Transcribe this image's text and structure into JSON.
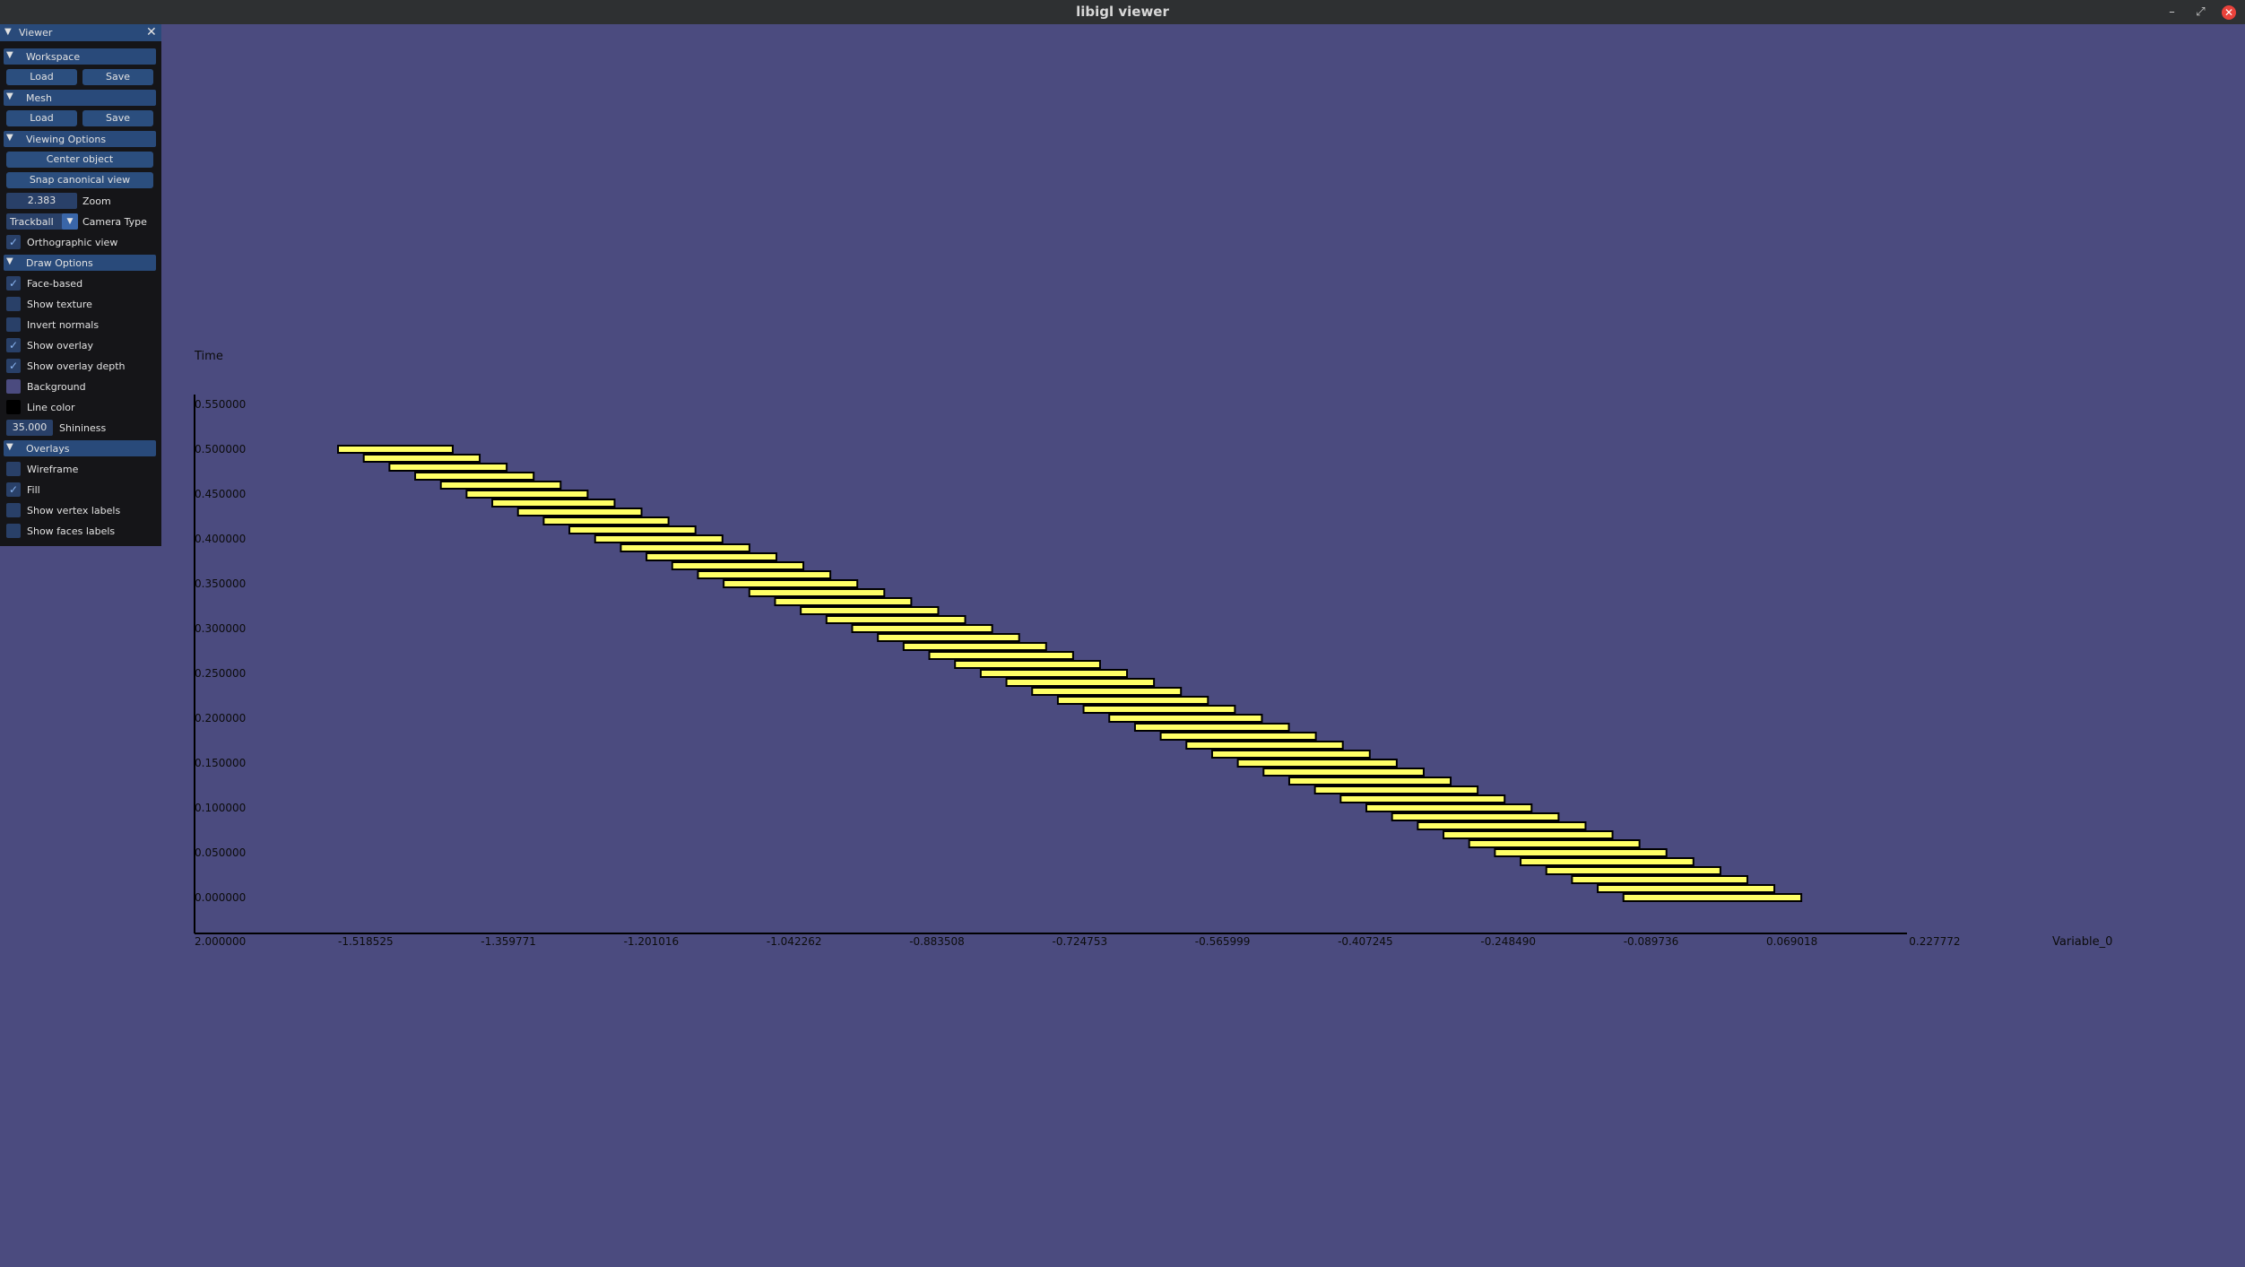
{
  "window": {
    "title": "libigl viewer",
    "minimize_glyph": "–",
    "maximize_glyph": "⤢",
    "close_glyph": "✕"
  },
  "panel": {
    "title": "Viewer",
    "close_glyph": "✕",
    "workspace": {
      "header": "Workspace",
      "load": "Load",
      "save": "Save"
    },
    "mesh": {
      "header": "Mesh",
      "load": "Load",
      "save": "Save"
    },
    "viewing": {
      "header": "Viewing Options",
      "center": "Center object",
      "snap": "Snap canonical view",
      "zoom_value": "2.383",
      "zoom_label": "Zoom",
      "camera_value": "Trackball",
      "camera_label": "Camera Type",
      "ortho_label": "Orthographic view",
      "ortho_checked": true
    },
    "draw": {
      "header": "Draw Options",
      "face_based": "Face-based",
      "face_based_checked": true,
      "show_texture": "Show texture",
      "show_texture_checked": false,
      "invert_normals": "Invert normals",
      "invert_normals_checked": false,
      "show_overlay": "Show overlay",
      "show_overlay_checked": true,
      "show_overlay_depth": "Show overlay depth",
      "show_overlay_depth_checked": true,
      "background": "Background",
      "background_color": "#4b4b7f",
      "line_color": "Line color",
      "line_color_value": "#000000",
      "shininess_value": "35.000",
      "shininess_label": "Shininess"
    },
    "overlays": {
      "header": "Overlays",
      "wireframe": "Wireframe",
      "wireframe_checked": false,
      "fill": "Fill",
      "fill_checked": true,
      "vertex_labels": "Show vertex labels",
      "vertex_labels_checked": false,
      "faces_labels": "Show faces labels",
      "faces_labels_checked": false
    }
  },
  "chart_data": {
    "type": "bar",
    "xlabel": "Variable_0",
    "ylabel": "Time",
    "x_ticks": [
      "-1.518525",
      "-1.359771",
      "-1.201016",
      "-1.042262",
      "-0.883508",
      "-0.724753",
      "-0.565999",
      "-0.407245",
      "-0.248490",
      "-0.089736",
      "0.069018",
      "0.227772"
    ],
    "x_tick_values": [
      -1.518525,
      -1.359771,
      -1.201016,
      -1.042262,
      -0.883508,
      -0.724753,
      -0.565999,
      -0.407245,
      -0.24849,
      -0.089736,
      0.069018,
      0.227772
    ],
    "x_first_tick_overlap": "2.000000",
    "y_ticks": [
      "0.000000",
      "0.050000",
      "0.100000",
      "0.150000",
      "0.200000",
      "0.250000",
      "0.300000",
      "0.350000",
      "0.400000",
      "0.450000",
      "0.500000",
      "0.550000"
    ],
    "y_tick_values": [
      0,
      0.05,
      0.1,
      0.15,
      0.2,
      0.25,
      0.3,
      0.35,
      0.4,
      0.45,
      0.5,
      0.55
    ],
    "xlim": [
      -1.67728,
      0.227772
    ],
    "ylim": [
      -0.04,
      0.55
    ],
    "bar_color": "#ffff66",
    "bar_stroke": "#000000",
    "bars": {
      "count": 51,
      "start_x_first": -1.5185,
      "start_x_last": -0.0897,
      "end_x_first": -1.391,
      "end_x_last": 0.108,
      "time_first": 0.5,
      "time_last": 0.0
    }
  }
}
